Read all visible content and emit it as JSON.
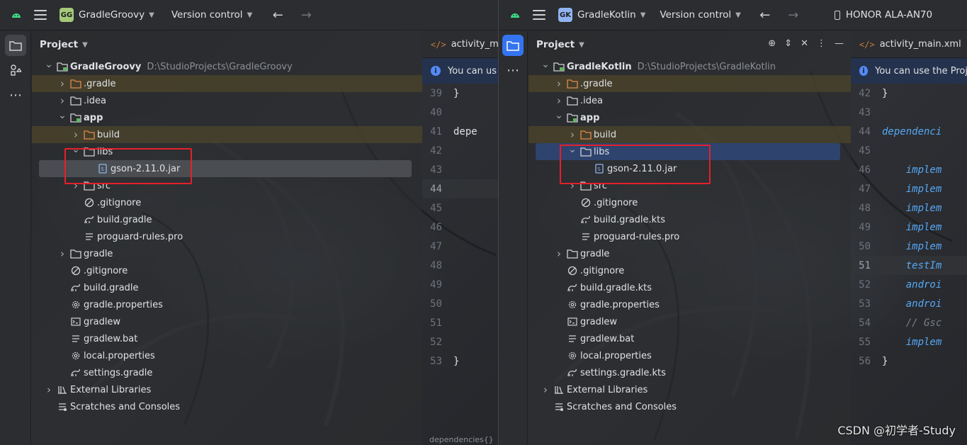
{
  "left_window": {
    "project_badge": "GG",
    "project_badge_color": "#a5c879",
    "project_name": "GradleGroovy",
    "vcs_label": "Version control",
    "panel_title": "Project",
    "tree": [
      {
        "label": "GradleGroovy",
        "path": "D:\\StudioProjects\\GradleGroovy",
        "depth": 0,
        "toggle": "open",
        "icon": "module-icon",
        "bold": true,
        "highlight": "none"
      },
      {
        "label": ".gradle",
        "depth": 1,
        "toggle": "closed",
        "icon": "folder-orange-icon",
        "highlight": "yellow"
      },
      {
        "label": ".idea",
        "depth": 1,
        "toggle": "closed",
        "icon": "folder-icon",
        "highlight": "none"
      },
      {
        "label": "app",
        "depth": 1,
        "toggle": "open",
        "icon": "module-icon",
        "bold": true,
        "highlight": "none"
      },
      {
        "label": "build",
        "depth": 2,
        "toggle": "closed",
        "icon": "folder-orange-icon",
        "highlight": "yellow"
      },
      {
        "label": "libs",
        "depth": 2,
        "toggle": "open",
        "icon": "folder-icon",
        "highlight": "none"
      },
      {
        "label": "gson-2.11.0.jar",
        "depth": 3,
        "toggle": "none",
        "icon": "jar-icon",
        "highlight": "grey"
      },
      {
        "label": "src",
        "depth": 2,
        "toggle": "closed",
        "icon": "folder-icon",
        "highlight": "none"
      },
      {
        "label": ".gitignore",
        "depth": 2,
        "toggle": "none",
        "icon": "ignore-icon",
        "highlight": "none"
      },
      {
        "label": "build.gradle",
        "depth": 2,
        "toggle": "none",
        "icon": "gradle-icon",
        "highlight": "none"
      },
      {
        "label": "proguard-rules.pro",
        "depth": 2,
        "toggle": "none",
        "icon": "text-file-icon",
        "highlight": "none"
      },
      {
        "label": "gradle",
        "depth": 1,
        "toggle": "closed",
        "icon": "folder-icon",
        "highlight": "none"
      },
      {
        "label": ".gitignore",
        "depth": 1,
        "toggle": "none",
        "icon": "ignore-icon",
        "highlight": "none"
      },
      {
        "label": "build.gradle",
        "depth": 1,
        "toggle": "none",
        "icon": "gradle-icon",
        "highlight": "none"
      },
      {
        "label": "gradle.properties",
        "depth": 1,
        "toggle": "none",
        "icon": "settings-gear-icon",
        "highlight": "none"
      },
      {
        "label": "gradlew",
        "depth": 1,
        "toggle": "none",
        "icon": "terminal-icon",
        "highlight": "none"
      },
      {
        "label": "gradlew.bat",
        "depth": 1,
        "toggle": "none",
        "icon": "text-file-icon",
        "highlight": "none"
      },
      {
        "label": "local.properties",
        "depth": 1,
        "toggle": "none",
        "icon": "settings-gear-icon",
        "highlight": "none"
      },
      {
        "label": "settings.gradle",
        "depth": 1,
        "toggle": "none",
        "icon": "gradle-icon",
        "highlight": "none"
      },
      {
        "label": "External Libraries",
        "depth": 0,
        "toggle": "closed",
        "icon": "library-icon",
        "highlight": "none"
      },
      {
        "label": "Scratches and Consoles",
        "depth": 0,
        "toggle": "none",
        "icon": "scratches-icon",
        "highlight": "none"
      }
    ],
    "editor": {
      "tab_label": "activity_mair",
      "banner_text": "You can us",
      "lines": [
        {
          "n": "39",
          "code": "}",
          "cls": "br"
        },
        {
          "n": "40",
          "code": "",
          "cls": "br"
        },
        {
          "n": "41",
          "code": "depe",
          "cls": "br"
        },
        {
          "n": "42",
          "code": "",
          "cls": "br"
        },
        {
          "n": "43",
          "code": "",
          "cls": "br"
        },
        {
          "n": "44",
          "code": "",
          "cls": "br",
          "current": true
        },
        {
          "n": "45",
          "code": "",
          "cls": "br"
        },
        {
          "n": "46",
          "code": "",
          "cls": "br"
        },
        {
          "n": "47",
          "code": "",
          "cls": "br"
        },
        {
          "n": "48",
          "code": "",
          "cls": "br"
        },
        {
          "n": "49",
          "code": "",
          "cls": "br"
        },
        {
          "n": "50",
          "code": "",
          "cls": "br"
        },
        {
          "n": "51",
          "code": "",
          "cls": "br"
        },
        {
          "n": "52",
          "code": "",
          "cls": "br"
        },
        {
          "n": "53",
          "code": "}",
          "cls": "br"
        }
      ],
      "status_text": "dependencies{}"
    }
  },
  "right_window": {
    "project_badge": "GK",
    "project_badge_color": "#8fb4f0",
    "project_name": "GradleKotlin",
    "vcs_label": "Version control",
    "device_label": "HONOR ALA-AN70",
    "panel_title": "Project",
    "tree": [
      {
        "label": "GradleKotlin",
        "path": "D:\\StudioProjects\\GradleKotlin",
        "depth": 0,
        "toggle": "open",
        "icon": "module-icon",
        "bold": true,
        "highlight": "none"
      },
      {
        "label": ".gradle",
        "depth": 1,
        "toggle": "closed",
        "icon": "folder-orange-icon",
        "highlight": "yellow"
      },
      {
        "label": ".idea",
        "depth": 1,
        "toggle": "closed",
        "icon": "folder-icon",
        "highlight": "none"
      },
      {
        "label": "app",
        "depth": 1,
        "toggle": "open",
        "icon": "module-icon",
        "bold": true,
        "highlight": "none"
      },
      {
        "label": "build",
        "depth": 2,
        "toggle": "closed",
        "icon": "folder-orange-icon",
        "highlight": "yellow"
      },
      {
        "label": "libs",
        "depth": 2,
        "toggle": "open",
        "icon": "folder-icon",
        "highlight": "blue"
      },
      {
        "label": "gson-2.11.0.jar",
        "depth": 3,
        "toggle": "none",
        "icon": "jar-icon",
        "highlight": "none"
      },
      {
        "label": "src",
        "depth": 2,
        "toggle": "closed",
        "icon": "folder-icon",
        "highlight": "none"
      },
      {
        "label": ".gitignore",
        "depth": 2,
        "toggle": "none",
        "icon": "ignore-icon",
        "highlight": "none"
      },
      {
        "label": "build.gradle.kts",
        "depth": 2,
        "toggle": "none",
        "icon": "gradle-icon",
        "highlight": "none"
      },
      {
        "label": "proguard-rules.pro",
        "depth": 2,
        "toggle": "none",
        "icon": "text-file-icon",
        "highlight": "none"
      },
      {
        "label": "gradle",
        "depth": 1,
        "toggle": "closed",
        "icon": "folder-icon",
        "highlight": "none"
      },
      {
        "label": ".gitignore",
        "depth": 1,
        "toggle": "none",
        "icon": "ignore-icon",
        "highlight": "none"
      },
      {
        "label": "build.gradle.kts",
        "depth": 1,
        "toggle": "none",
        "icon": "gradle-icon",
        "highlight": "none"
      },
      {
        "label": "gradle.properties",
        "depth": 1,
        "toggle": "none",
        "icon": "settings-gear-icon",
        "highlight": "none"
      },
      {
        "label": "gradlew",
        "depth": 1,
        "toggle": "none",
        "icon": "terminal-icon",
        "highlight": "none"
      },
      {
        "label": "gradlew.bat",
        "depth": 1,
        "toggle": "none",
        "icon": "text-file-icon",
        "highlight": "none"
      },
      {
        "label": "local.properties",
        "depth": 1,
        "toggle": "none",
        "icon": "settings-gear-icon",
        "highlight": "none"
      },
      {
        "label": "settings.gradle.kts",
        "depth": 1,
        "toggle": "none",
        "icon": "gradle-icon",
        "highlight": "none"
      },
      {
        "label": "External Libraries",
        "depth": 0,
        "toggle": "closed",
        "icon": "library-icon",
        "highlight": "none"
      },
      {
        "label": "Scratches and Consoles",
        "depth": 0,
        "toggle": "none",
        "icon": "scratches-icon",
        "highlight": "none"
      }
    ],
    "editor": {
      "tab_label": "activity_main.xml",
      "banner_text": "You can use the Proj",
      "lines": [
        {
          "n": "42",
          "code": "}",
          "cls": "br"
        },
        {
          "n": "43",
          "code": "",
          "cls": "br"
        },
        {
          "n": "44",
          "code": "dependenci",
          "cls": "kw"
        },
        {
          "n": "45",
          "code": "",
          "cls": "br"
        },
        {
          "n": "46",
          "code": "    implem",
          "cls": "kw"
        },
        {
          "n": "47",
          "code": "    implem",
          "cls": "kw"
        },
        {
          "n": "48",
          "code": "    implem",
          "cls": "kw"
        },
        {
          "n": "49",
          "code": "    implem",
          "cls": "kw"
        },
        {
          "n": "50",
          "code": "    implem",
          "cls": "kw"
        },
        {
          "n": "51",
          "code": "    testIm",
          "cls": "kw",
          "current": true
        },
        {
          "n": "52",
          "code": "    androi",
          "cls": "kw"
        },
        {
          "n": "53",
          "code": "    androi",
          "cls": "kw"
        },
        {
          "n": "54",
          "code": "    // Gsc",
          "cls": "cm"
        },
        {
          "n": "55",
          "code": "    implem",
          "cls": "kw"
        },
        {
          "n": "56",
          "code": "}",
          "cls": "br"
        }
      ]
    }
  },
  "watermark": "CSDN @初学者-Study",
  "colors": {
    "highlight_box": "#e5202a",
    "selection_blue": "#2e436e",
    "accent": "#3574f0"
  }
}
